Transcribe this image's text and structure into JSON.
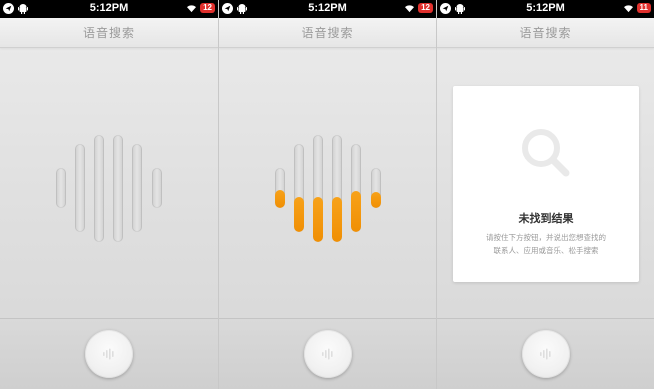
{
  "screens": [
    {
      "status": {
        "time": "5:12PM",
        "badge": "12"
      },
      "title": "语音搜索",
      "state": "idle",
      "levels": [
        0,
        0,
        0,
        0,
        0,
        0
      ]
    },
    {
      "status": {
        "time": "5:12PM",
        "badge": "12"
      },
      "title": "语音搜索",
      "state": "listening",
      "levels": [
        0.45,
        0.4,
        0.42,
        0.42,
        0.47,
        0.4
      ]
    },
    {
      "status": {
        "time": "5:12PM",
        "badge": "11"
      },
      "title": "语音搜索",
      "state": "no-result",
      "result": {
        "heading": "未找到结果",
        "hint_line1": "请按住下方按钮，并说出您想查找的",
        "hint_line2": "联系人、应用或音乐、松手搜索"
      }
    }
  ],
  "colors": {
    "accent": "#f39a0e",
    "status_badge": "#e0302d"
  },
  "icons": [
    "navigation-icon",
    "android-icon",
    "wifi-icon",
    "search-icon",
    "microphone-icon"
  ]
}
